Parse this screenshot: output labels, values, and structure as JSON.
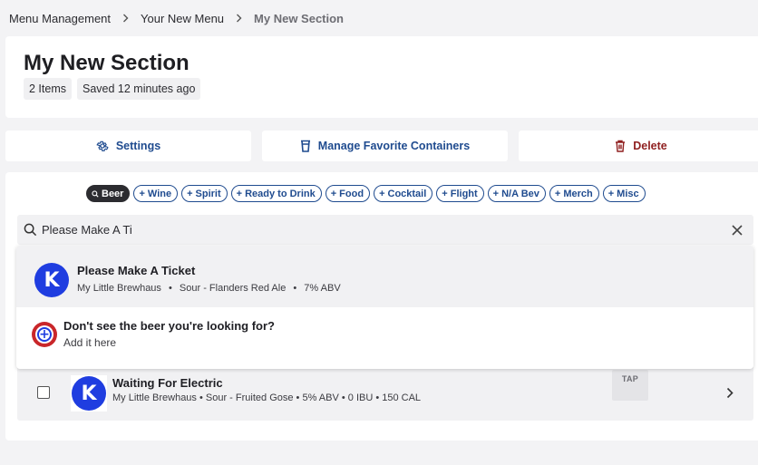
{
  "breadcrumb": {
    "items": [
      "Menu Management",
      "Your New Menu",
      "My New Section"
    ]
  },
  "header": {
    "title": "My New Section",
    "item_count": "2 Items",
    "saved": "Saved 12 minutes ago"
  },
  "actions": {
    "settings": "Settings",
    "containers": "Manage Favorite Containers",
    "delete": "Delete"
  },
  "filters": {
    "chips": [
      {
        "label": "Beer",
        "active": true,
        "icon": "search-icon"
      },
      {
        "label": "Wine",
        "icon": "plus-icon"
      },
      {
        "label": "Spirit",
        "icon": "plus-icon"
      },
      {
        "label": "Ready to Drink",
        "icon": "plus-icon"
      },
      {
        "label": "Food",
        "icon": "plus-icon"
      },
      {
        "label": "Cocktail",
        "icon": "plus-icon"
      },
      {
        "label": "Flight",
        "icon": "plus-icon"
      },
      {
        "label": "N/A Bev",
        "icon": "plus-icon"
      },
      {
        "label": "Merch",
        "icon": "plus-icon"
      },
      {
        "label": "Misc",
        "icon": "plus-icon"
      }
    ]
  },
  "search": {
    "value": "Please Make A Ti"
  },
  "dropdown": {
    "result": {
      "logo": "K",
      "title": "Please Make A Ticket",
      "brewery": "My Little Brewhaus",
      "style": "Sour - Flanders Red Ale",
      "abv": "7% ABV",
      "separator": "•"
    },
    "add": {
      "title": "Don't see the beer you're looking for?",
      "subtitle": "Add it here"
    }
  },
  "items": [
    {
      "logo": "K",
      "title": "Waiting For Electric",
      "details": "My Little Brewhaus • Sour - Fruited Gose • 5% ABV • 0 IBU • 150 CAL",
      "badge": "TAP"
    }
  ],
  "colors": {
    "accent": "#1f4b8f",
    "danger": "#8f1f1f",
    "logo": "#1f3de0"
  }
}
